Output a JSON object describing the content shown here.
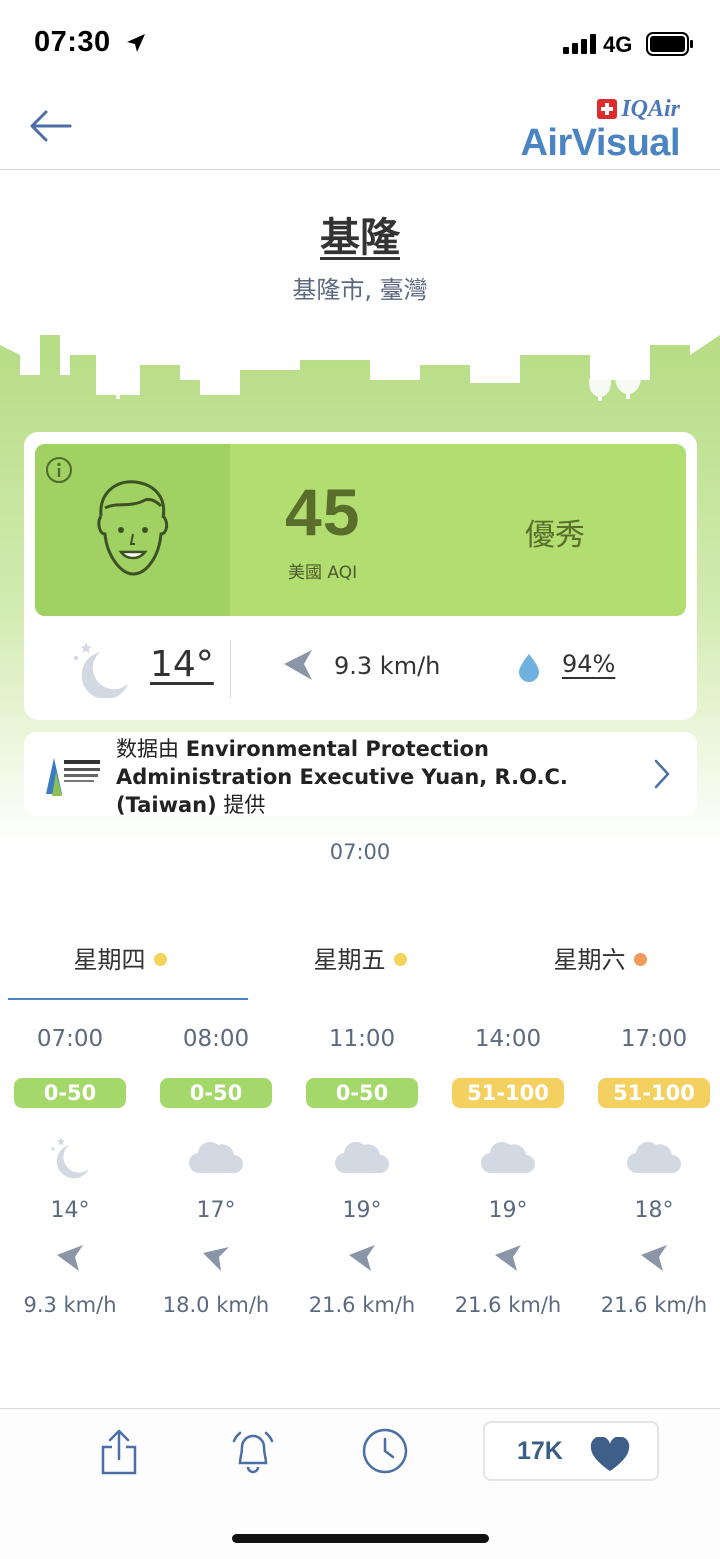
{
  "status": {
    "time": "07:30",
    "network": "4G"
  },
  "app": {
    "brand_top": "IQAir",
    "brand_bottom": "AirVisual"
  },
  "location": {
    "city": "基隆",
    "region": "基隆市, 臺灣"
  },
  "current": {
    "aqi": "45",
    "aqi_label": "美國 AQI",
    "status": "優秀",
    "temperature": "14°",
    "wind": "9.3 km/h",
    "humidity": "94%",
    "aqi_color": "#b2dd70"
  },
  "source": {
    "prefix": "数据由 ",
    "name": "Environmental Protection Administration Executive Yuan, R.O.C. (Taiwan)",
    "suffix": " 提供"
  },
  "updated_time": "07:00",
  "tabs": [
    {
      "label": "星期四",
      "dot_color": "#f4d35a",
      "selected": true
    },
    {
      "label": "星期五",
      "dot_color": "#f4d35a",
      "selected": false
    },
    {
      "label": "星期六",
      "dot_color": "#f09a5b",
      "selected": false
    }
  ],
  "hourly": [
    {
      "time": "07:00",
      "aqi": "0-50",
      "aqi_color": "#a5d86a",
      "icon": "moon-icon",
      "temp": "14°",
      "wind": "9.3 km/h"
    },
    {
      "time": "08:00",
      "aqi": "0-50",
      "aqi_color": "#a5d86a",
      "icon": "cloud-icon",
      "temp": "17°",
      "wind": "18.0 km/h"
    },
    {
      "time": "11:00",
      "aqi": "0-50",
      "aqi_color": "#a5d86a",
      "icon": "cloud-icon",
      "temp": "19°",
      "wind": "21.6 km/h"
    },
    {
      "time": "14:00",
      "aqi": "51-100",
      "aqi_color": "#f3d060",
      "icon": "cloud-icon",
      "temp": "19°",
      "wind": "21.6 km/h"
    },
    {
      "time": "17:00",
      "aqi": "51-100",
      "aqi_color": "#f3d060",
      "icon": "cloud-icon",
      "temp": "18°",
      "wind": "21.6 km/h"
    }
  ],
  "toolbar": {
    "likes": "17K"
  }
}
